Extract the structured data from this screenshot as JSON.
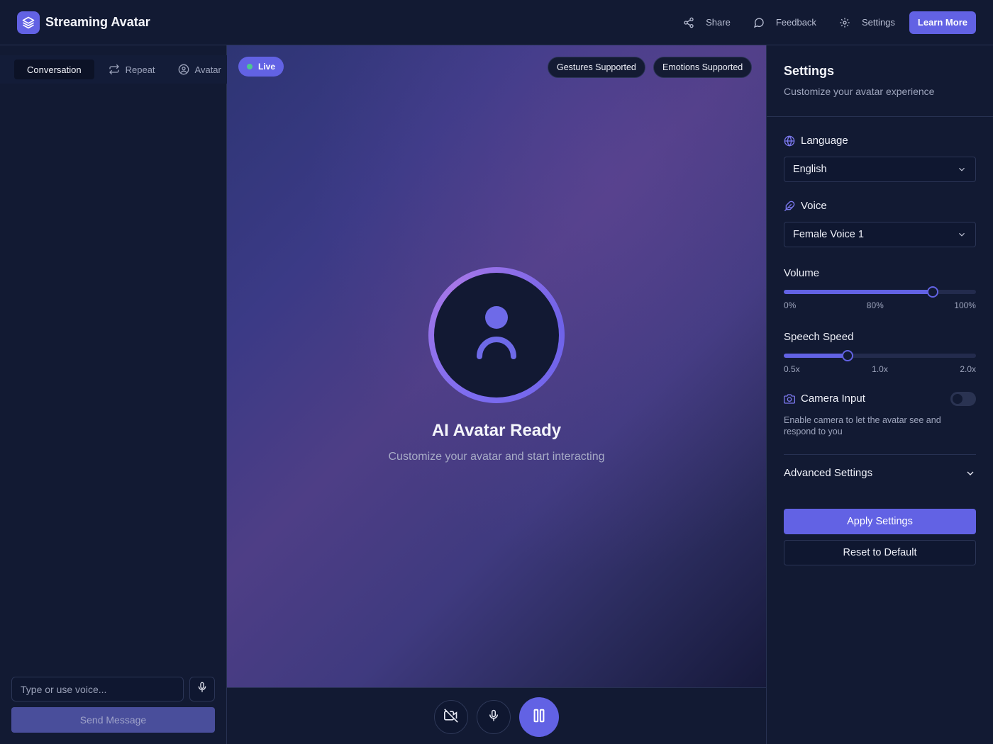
{
  "header": {
    "title": "Streaming Avatar",
    "logo_icon": "layers-icon",
    "share_label": "Share",
    "feedback_label": "Feedback",
    "settings_label": "Settings",
    "learn_more_label": "Learn More"
  },
  "left_panel": {
    "tabs": [
      {
        "label": "Conversation",
        "icon": "",
        "active": true
      },
      {
        "label": "Repeat",
        "icon": "repeat-icon",
        "active": false
      },
      {
        "label": "Avatar",
        "icon": "user-circle-icon",
        "active": false
      }
    ],
    "input_placeholder": "Type or use voice...",
    "send_label": "Send Message"
  },
  "stage": {
    "live_label": "Live",
    "badges": [
      "Gestures Supported",
      "Emotions Supported"
    ],
    "ready_title": "AI Avatar Ready",
    "ready_subtitle": "Customize your avatar and start interacting"
  },
  "controls": {
    "camera_off_icon": "video-off-icon",
    "mic_icon": "mic-icon",
    "pause_icon": "pause-icon"
  },
  "settings": {
    "title": "Settings",
    "subtitle": "Customize your avatar experience",
    "language": {
      "label": "Language",
      "value": "English"
    },
    "voice": {
      "label": "Voice",
      "value": "Female Voice 1"
    },
    "volume": {
      "label": "Volume",
      "value_percent": 80,
      "ticks": [
        "0%",
        "80%",
        "100%"
      ]
    },
    "speech_speed": {
      "label": "Speech Speed",
      "value": 1.0,
      "min": 0.5,
      "max": 2.0,
      "ticks": [
        "0.5x",
        "1.0x",
        "2.0x"
      ]
    },
    "camera": {
      "label": "Camera Input",
      "enabled": false,
      "description": "Enable camera to let the avatar see and respond to you"
    },
    "advanced_label": "Advanced Settings",
    "apply_label": "Apply Settings",
    "reset_label": "Reset to Default"
  },
  "colors": {
    "accent": "#6262e4",
    "background": "#121a33",
    "live_dot": "#4cc98e"
  }
}
